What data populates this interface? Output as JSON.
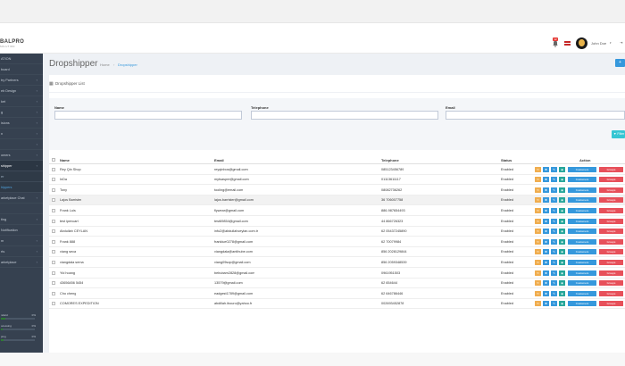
{
  "topbar": {
    "logo_main": "BALPRO",
    "logo_sub": "SOLUTION",
    "notif_count": "12",
    "username": "John Doe",
    "user_caret": "▾"
  },
  "sidebar": {
    "items": [
      {
        "label": "ATION",
        "chev": ""
      },
      {
        "label": "board",
        "chev": ""
      },
      {
        "label": "try Partners",
        "chev": "‹"
      },
      {
        "label": "eb Design",
        "chev": "‹"
      },
      {
        "label": "ket",
        "chev": "‹"
      },
      {
        "label": "g",
        "chev": "‹"
      },
      {
        "label": "isions",
        "chev": "‹"
      },
      {
        "label": "n",
        "chev": "‹"
      },
      {
        "label": "",
        "chev": "‹"
      },
      {
        "label": "omers",
        "chev": "‹"
      },
      {
        "label": "shipper",
        "chev": "‹"
      },
      {
        "label": "er",
        "chev": ""
      },
      {
        "label": "hippers",
        "chev": ""
      },
      {
        "label": "arketplace Chat",
        "chev": "‹"
      },
      {
        "label": "",
        "chev": ""
      },
      {
        "label": "ting",
        "chev": "‹"
      },
      {
        "label": "Notification",
        "chev": ""
      },
      {
        "label": "m",
        "chev": "‹"
      },
      {
        "label": "rts",
        "chev": "‹"
      },
      {
        "label": "arketplace",
        "chev": "‹"
      }
    ],
    "progress": [
      {
        "label": "ndard",
        "pct": "0%",
        "value": 0.12
      },
      {
        "label": "ocessing",
        "pct": "0%",
        "value": 0.05
      },
      {
        "label": "ping",
        "pct": "0%",
        "value": 0.08
      }
    ]
  },
  "page": {
    "title": "Dropshipper",
    "breadcrumb_home": "Home",
    "breadcrumb_sep": "›",
    "breadcrumb_current": "Dropshipper",
    "add_label": "+"
  },
  "portlet": {
    "title": "Dropshipper List"
  },
  "filter": {
    "name_label": "Name",
    "telephone_label": "Telephone",
    "email_label": "Email",
    "name_value": "",
    "telephone_value": "",
    "email_value": "",
    "filter_button": "▼ Filter"
  },
  "table": {
    "headers": {
      "name": "Name",
      "email": "Email",
      "telephone": "Telephone",
      "status": "Status",
      "action": "Action"
    },
    "actions": {
      "customers": "Customers",
      "groups": "Groups"
    },
    "rows": [
      {
        "name": "Rey Qin Shop",
        "email": "reyqinbos@gmail.com",
        "telephone": "085123456789",
        "status": "Enabled"
      },
      {
        "name": "InDa",
        "email": "mytsaspre@gmail.com",
        "telephone": "01113611117",
        "status": "Enabled"
      },
      {
        "name": "Tony",
        "email": "tooling@email.com",
        "telephone": "08082736262",
        "status": "Enabled"
      },
      {
        "name": "Lajos Barrister",
        "email": "lajos.barrister@gmail.com",
        "telephone": "36 706007758",
        "status": "Enabled"
      },
      {
        "name": "Frank Luis",
        "email": "flywear@gmail.com",
        "telephone": "886-987654493",
        "status": "Enabled"
      },
      {
        "name": "test ipencart",
        "email": "test69854@gmail.com",
        "telephone": "44 866726323",
        "status": "Enabled"
      },
      {
        "name": "Abdullah CEYLAN",
        "email": "info2@abdullahceylan.com.tr",
        "telephone": "62 05437245890",
        "status": "Enabled"
      },
      {
        "name": "Frank 888",
        "email": "franklue0278@gmail.com",
        "telephone": "62 70079984",
        "status": "Enabled"
      },
      {
        "name": "viang seca",
        "email": "viangdala@antihube.com",
        "telephone": "856 2028129844",
        "status": "Enabled"
      },
      {
        "name": "viangdala sema",
        "email": "viang09sop@gmail.com",
        "telephone": "856 2059348539",
        "status": "Enabled"
      },
      {
        "name": "Yid hoang",
        "email": "bebubam2828@gmail.com",
        "telephone": "0961951503",
        "status": "Enabled"
      },
      {
        "name": "43656456 5454",
        "email": "13579@gmail.com",
        "telephone": "62 654644",
        "status": "Enabled"
      },
      {
        "name": "Cho cheng",
        "email": "eadgest1789@gmail.com",
        "telephone": "62 646786446",
        "status": "Enabled"
      },
      {
        "name": "COMORES EXPEDITION",
        "email": "abdillah.ibouro@yahoo.fr",
        "telephone": "002693452878",
        "status": "Enabled"
      }
    ]
  },
  "colors": {
    "sidebar_bg": "#364150",
    "accent_blue": "#3598dc",
    "action_orange": "#f0ad4e",
    "action_green": "#26a69a",
    "action_red": "#e7505a",
    "filter_teal": "#36c6d3"
  }
}
